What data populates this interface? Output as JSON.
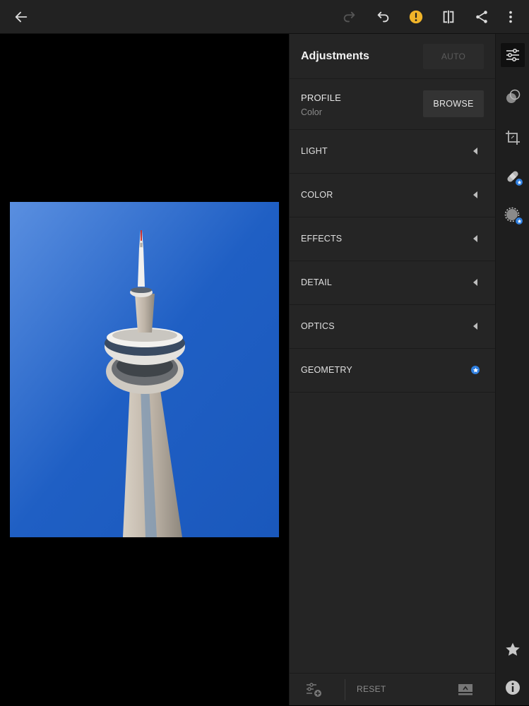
{
  "toolbar": {
    "icons": [
      "back-arrow-icon",
      "redo-icon",
      "undo-icon",
      "warning-icon",
      "compare-icon",
      "share-icon",
      "more-vertical-icon"
    ],
    "warning_color": "#f0b429"
  },
  "panel": {
    "title": "Adjustments",
    "auto_label": "AUTO",
    "profile": {
      "label": "PROFILE",
      "value": "Color",
      "browse_label": "BROWSE"
    },
    "sections": [
      {
        "label": "LIGHT"
      },
      {
        "label": "COLOR"
      },
      {
        "label": "EFFECTS"
      },
      {
        "label": "DETAIL"
      },
      {
        "label": "OPTICS"
      },
      {
        "label": "GEOMETRY",
        "badge": "star"
      }
    ],
    "footer": {
      "reset_label": "RESET"
    }
  },
  "toolstrip": {
    "tools": [
      "adjustments-icon",
      "selective-icon",
      "crop-icon",
      "healing-icon",
      "radial-icon"
    ],
    "bottom": [
      "rating-star-icon",
      "info-icon"
    ],
    "accent": "#2f7fe0"
  }
}
